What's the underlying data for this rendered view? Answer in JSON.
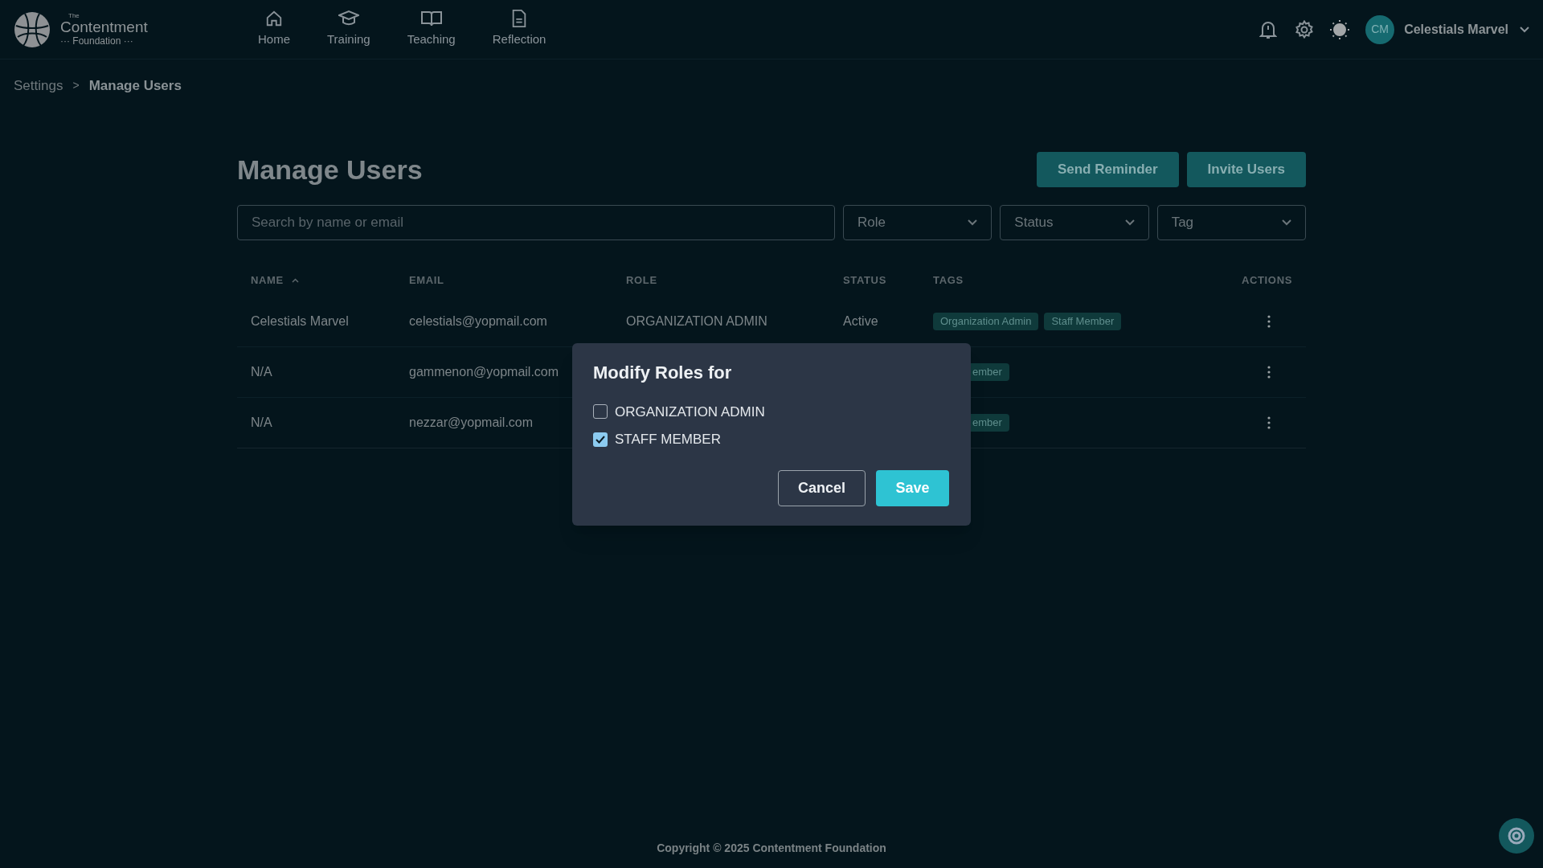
{
  "brand": {
    "small": "The",
    "name": "Contentment",
    "sub": "··· Foundation ···"
  },
  "nav": [
    {
      "label": "Home"
    },
    {
      "label": "Training"
    },
    {
      "label": "Teaching"
    },
    {
      "label": "Reflection"
    }
  ],
  "user": {
    "initials": "CM",
    "name": "Celestials Marvel"
  },
  "breadcrumb": [
    "Settings",
    ">",
    "Manage Users"
  ],
  "page_title": "Manage Users",
  "buttons": [
    "Send Reminder",
    "Invite Users"
  ],
  "search": {
    "placeholder": "Search by name or email"
  },
  "filters": [
    "Role",
    "Status",
    "Tag"
  ],
  "table": {
    "columns": [
      "NAME",
      "EMAIL",
      "ROLE",
      "STATUS",
      "TAGS",
      "ACTIONS"
    ],
    "rows": [
      {
        "name": "Celestials Marvel",
        "email": "celestials@yopmail.com",
        "role": "ORGANIZATION ADMIN",
        "status": "Active",
        "tags": [
          {
            "label": "Organization Admin",
            "kind": "full"
          },
          {
            "label": "Staff Member",
            "kind": "full"
          }
        ]
      },
      {
        "name": "N/A",
        "email": "gammenon@yopmail.com",
        "tags": [
          {
            "label": "ember",
            "kind": "cut"
          }
        ]
      },
      {
        "name": "N/A",
        "email": "nezzar@yopmail.com",
        "tags": [
          {
            "label": "ember",
            "kind": "cut"
          }
        ]
      }
    ]
  },
  "dialog": {
    "title": "Modify Roles for",
    "options": [
      {
        "label": "ORGANIZATION ADMIN",
        "checked": false
      },
      {
        "label": "STAFF MEMBER",
        "checked": true
      }
    ],
    "cancel": "Cancel",
    "save": "Save"
  },
  "footer": "Copyright © 2025 Contentment Foundation"
}
